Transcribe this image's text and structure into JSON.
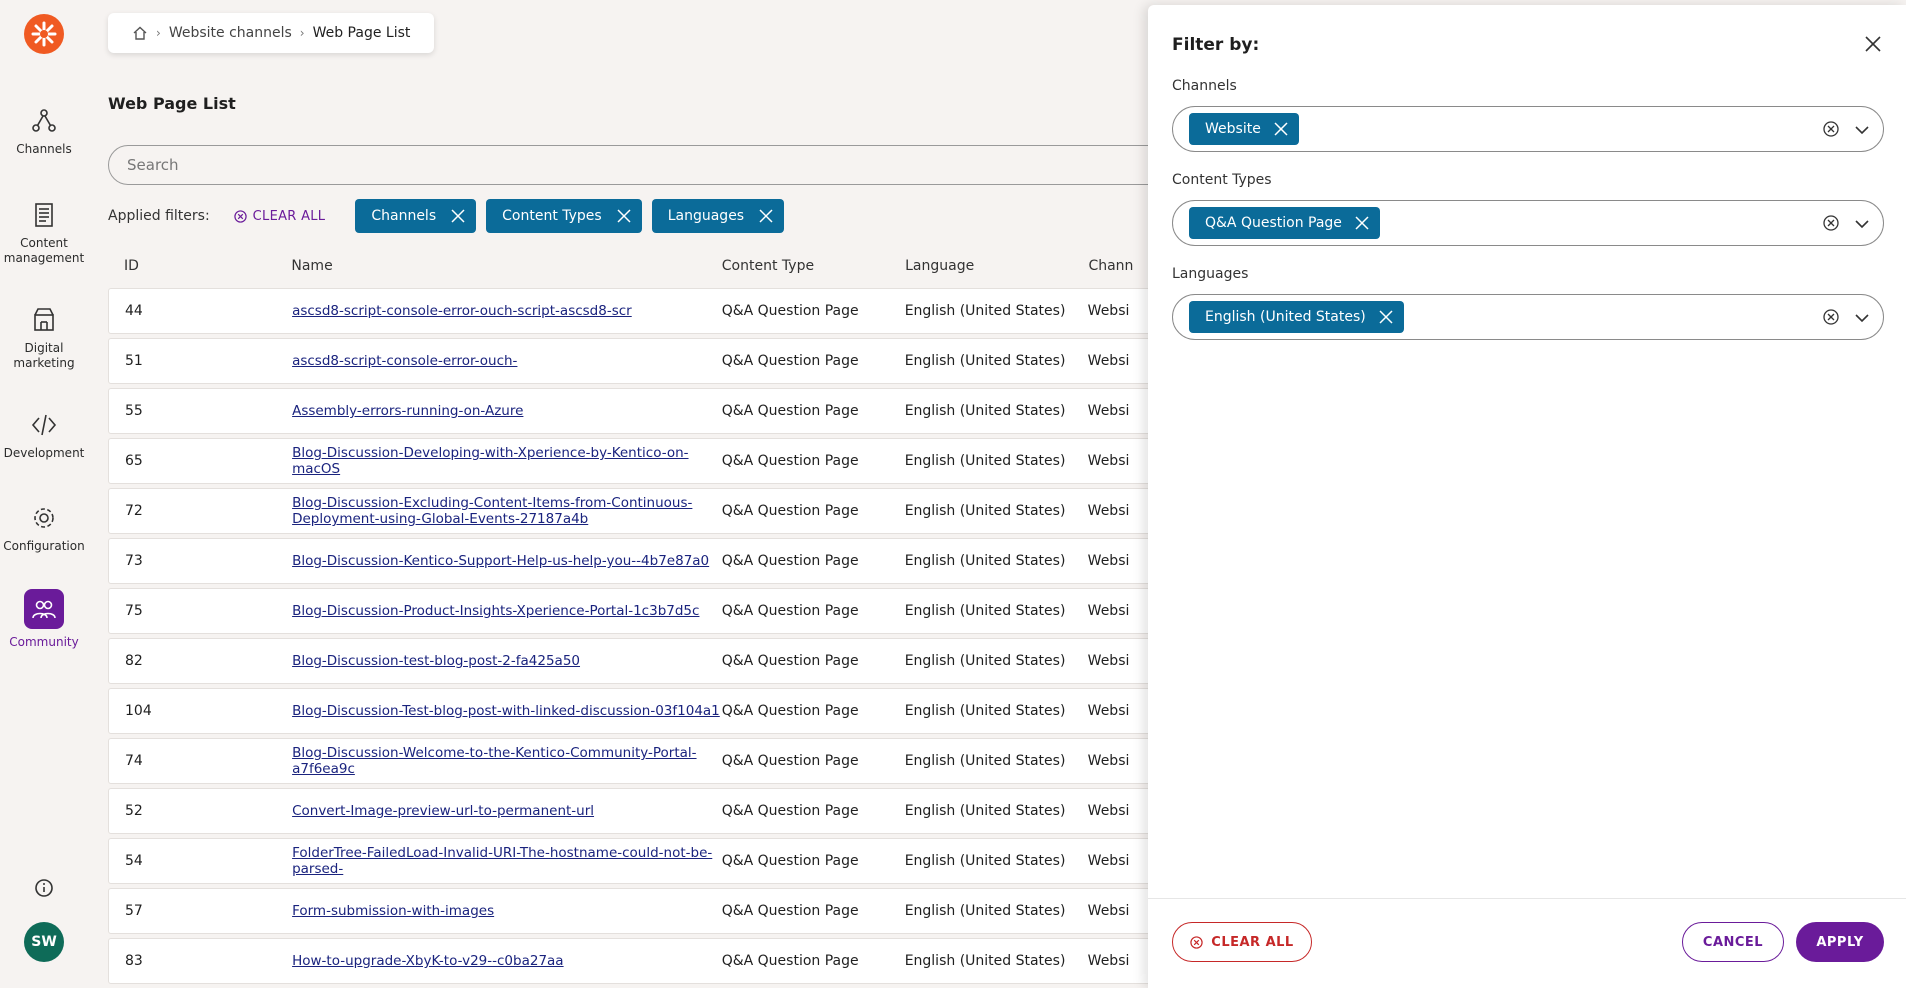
{
  "sidebar": {
    "items": [
      {
        "label": "Channels",
        "icon": "channels-icon"
      },
      {
        "label": "Content management",
        "icon": "content-management-icon"
      },
      {
        "label": "Digital marketing",
        "icon": "digital-marketing-icon"
      },
      {
        "label": "Development",
        "icon": "development-icon"
      },
      {
        "label": "Configuration",
        "icon": "configuration-icon"
      },
      {
        "label": "Community",
        "icon": "community-icon"
      }
    ],
    "avatar_initials": "SW"
  },
  "breadcrumb": {
    "items": [
      "Website channels",
      "Web Page List"
    ]
  },
  "page": {
    "title": "Web Page List",
    "search_placeholder": "Search"
  },
  "applied_filters": {
    "label": "Applied filters:",
    "clear_all": "CLEAR ALL",
    "chips": [
      "Channels",
      "Content Types",
      "Languages"
    ]
  },
  "table": {
    "columns": [
      "ID",
      "Name",
      "Content Type",
      "Language",
      "Chann"
    ],
    "rows": [
      {
        "id": "44",
        "name": "ascsd8-script-console-error-ouch-script-ascsd8-scr",
        "content_type": "Q&A Question Page",
        "language": "English (United States)",
        "channel": "Websi"
      },
      {
        "id": "51",
        "name": "ascsd8-script-console-error-ouch-",
        "content_type": "Q&A Question Page",
        "language": "English (United States)",
        "channel": "Websi"
      },
      {
        "id": "55",
        "name": "Assembly-errors-running-on-Azure",
        "content_type": "Q&A Question Page",
        "language": "English (United States)",
        "channel": "Websi"
      },
      {
        "id": "65",
        "name": "Blog-Discussion-Developing-with-Xperience-by-Kentico-on-macOS",
        "content_type": "Q&A Question Page",
        "language": "English (United States)",
        "channel": "Websi"
      },
      {
        "id": "72",
        "name": "Blog-Discussion-Excluding-Content-Items-from-Continuous-Deployment-using-Global-Events-27187a4b",
        "content_type": "Q&A Question Page",
        "language": "English (United States)",
        "channel": "Websi"
      },
      {
        "id": "73",
        "name": "Blog-Discussion-Kentico-Support-Help-us-help-you--4b7e87a0",
        "content_type": "Q&A Question Page",
        "language": "English (United States)",
        "channel": "Websi"
      },
      {
        "id": "75",
        "name": "Blog-Discussion-Product-Insights-Xperience-Portal-1c3b7d5c",
        "content_type": "Q&A Question Page",
        "language": "English (United States)",
        "channel": "Websi"
      },
      {
        "id": "82",
        "name": "Blog-Discussion-test-blog-post-2-fa425a50",
        "content_type": "Q&A Question Page",
        "language": "English (United States)",
        "channel": "Websi"
      },
      {
        "id": "104",
        "name": "Blog-Discussion-Test-blog-post-with-linked-discussion-03f104a1",
        "content_type": "Q&A Question Page",
        "language": "English (United States)",
        "channel": "Websi"
      },
      {
        "id": "74",
        "name": "Blog-Discussion-Welcome-to-the-Kentico-Community-Portal-a7f6ea9c",
        "content_type": "Q&A Question Page",
        "language": "English (United States)",
        "channel": "Websi"
      },
      {
        "id": "52",
        "name": "Convert-Image-preview-url-to-permanent-url",
        "content_type": "Q&A Question Page",
        "language": "English (United States)",
        "channel": "Websi"
      },
      {
        "id": "54",
        "name": "FolderTree-FailedLoad-Invalid-URI-The-hostname-could-not-be-parsed-",
        "content_type": "Q&A Question Page",
        "language": "English (United States)",
        "channel": "Websi"
      },
      {
        "id": "57",
        "name": "Form-submission-with-images",
        "content_type": "Q&A Question Page",
        "language": "English (United States)",
        "channel": "Websi"
      },
      {
        "id": "83",
        "name": "How-to-upgrade-XbyK-to-v29--c0ba27aa",
        "content_type": "Q&A Question Page",
        "language": "English (United States)",
        "channel": "Websi"
      }
    ]
  },
  "filter_panel": {
    "title": "Filter by:",
    "fields": [
      {
        "label": "Channels",
        "chip": "Website"
      },
      {
        "label": "Content Types",
        "chip": "Q&A Question Page"
      },
      {
        "label": "Languages",
        "chip": "English (United States)"
      }
    ],
    "clear_all": "CLEAR ALL",
    "cancel": "CANCEL",
    "apply": "APPLY"
  },
  "colors": {
    "accent_purple": "#6a1b9a",
    "chip_blue": "#0b6b99",
    "logo_orange": "#f05a22",
    "danger_red": "#c62828"
  }
}
